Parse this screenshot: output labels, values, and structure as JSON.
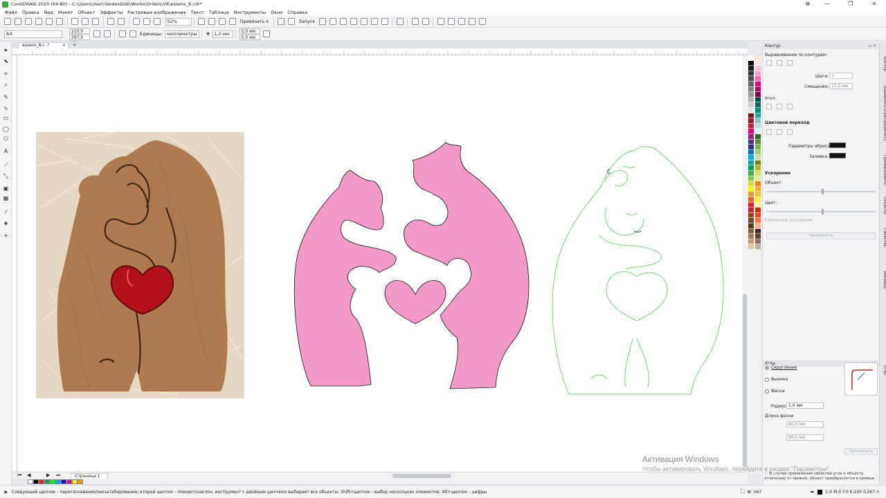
{
  "window": {
    "title": "CorelDRAW 2020 (64-Bit) - C:\\Users\\User\\YandexDisk\\Works\\Orders\\VK\\essens_8.cdr*",
    "controls": [
      "—",
      "❐",
      "✕"
    ],
    "restore_icon": "⧉"
  },
  "menu": [
    "Файл",
    "Правка",
    "Вид",
    "Макет",
    "Объект",
    "Эффекты",
    "Растровые изображения",
    "Текст",
    "Таблица",
    "Инструменты",
    "Окно",
    "Справка"
  ],
  "toolbar": {
    "zoom": "52%",
    "snap_label": "Привязать к",
    "launch_label": "Запуск"
  },
  "property_bar": {
    "page_size": "A4",
    "width": "210,0 мм",
    "height": "297,0 мм",
    "units_label": "Единицы:",
    "units_value": "миллиметры",
    "nudge": "1,0 мм",
    "dup_x": "5,0 мм",
    "dup_y": "5,0 мм"
  },
  "document_tab": "essens_8.c..*",
  "page_tab": "Страница 1",
  "contour_docker": {
    "title": "Контур",
    "align_label": "Выравнивание по контурам:",
    "step_label": "Шаги:",
    "step_value": "1",
    "offset_label": "Смещение:",
    "offset_value": "10,5 мм",
    "corner_label": "Угол:",
    "color_blend_label": "Цветовой переход",
    "outline_params_label": "Параметры абриса:",
    "fill_label": "Заливка:",
    "accel_label": "Ускорение",
    "object_label": "Объект:",
    "color_label": "Цвет:",
    "link_accel_label": "Связанное ускорение",
    "apply_label": "Применить",
    "swatch_color": "#111111"
  },
  "corners_docker": {
    "title": "Углы",
    "options": [
      "Скругление",
      "Выемка",
      "Фаска"
    ],
    "selected": "Скругление",
    "radius_label": "Радиус:",
    "radius_value": "1,0 мм",
    "chamfer_label": "Длина фаски",
    "chamfer_1": "80,0 мм",
    "chamfer_2": "80,0 мм",
    "apply_label": "Применить"
  },
  "side_tabs": [
    "Контур",
    "Выровнять и распределить",
    "Преобразовать",
    "Объекты",
    "Свойства",
    "Макросы",
    "Углы"
  ],
  "watermark": {
    "line1": "Активация Windows",
    "line2": "Чтобы активировать Windows, перейдите в раздел \"Параметры\"."
  },
  "info_note": "В случае применения свойства угла к объекту, отличному от кривой, объект преобразуется в кривые.",
  "status": {
    "hint": "Следующий щелчок - перетаскивание/масштабирование; второй щелчок - поворот/наклон; инструмент с двойным щелчком выбирает все объекты; Shift+щелчок - выбор нескольких элементов; Alt+щелчок - цифры",
    "fill_label": "Нет",
    "outline_info": "C:0 M:0 Y:0 K:100  0,567 п"
  },
  "colors": {
    "pink_fill": "#f49ac9",
    "green_outline": "#66d466",
    "heart_red": "#b3121c",
    "wood": "#b07a4f"
  },
  "palette": [
    "#ffffff",
    "#000000",
    "#1a1a1a",
    "#333333",
    "#4d4d4d",
    "#666666",
    "#808080",
    "#999999",
    "#b3b3b3",
    "#cccccc",
    "#e6e6e6",
    "#7a0b18",
    "#9b1a2a",
    "#c21f3a",
    "#e3007a",
    "#8e2a7a",
    "#5b2a86",
    "#2e3192",
    "#0072bc",
    "#00aeef",
    "#00a99d",
    "#00a651",
    "#39b54a",
    "#8dc63f",
    "#d7df23",
    "#fff200",
    "#f7941d",
    "#f26522",
    "#ed1c24",
    "#c1272d",
    "#a0410d",
    "#754c24",
    "#603913",
    "#8c6239",
    "#a67c52",
    "#c69c6d",
    "#e2c89c",
    "#f9e9c9",
    "#ffe3ee",
    "#ffc2dd",
    "#ff99cc",
    "#ff66b3",
    "#e6007e",
    "#b00062",
    "#7d0048",
    "#004d40",
    "#00695c",
    "#00897b",
    "#26a69a",
    "#80cbc4",
    "#b2dfdb",
    "#e0f2f1",
    "#33691e",
    "#558b2f",
    "#7cb342",
    "#9ccc65",
    "#c5e1a5",
    "#827717",
    "#afb42b",
    "#d4e157",
    "#e6ee9c",
    "#f57f17",
    "#f9a825",
    "#fbc02d",
    "#ffeb3b",
    "#fff59d",
    "#bf360c",
    "#e64a19",
    "#ff7043",
    "#ffab91",
    "#3e2723",
    "#5d4037",
    "#8d6e63",
    "#bcaaa4"
  ],
  "doc_palette": [
    "#ffffff",
    "#000000",
    "#ed1c24",
    "#00a651",
    "#00ff00",
    "#00aeef",
    "#0000ff",
    "#ec008c",
    "#fff200",
    "#f7941d"
  ]
}
